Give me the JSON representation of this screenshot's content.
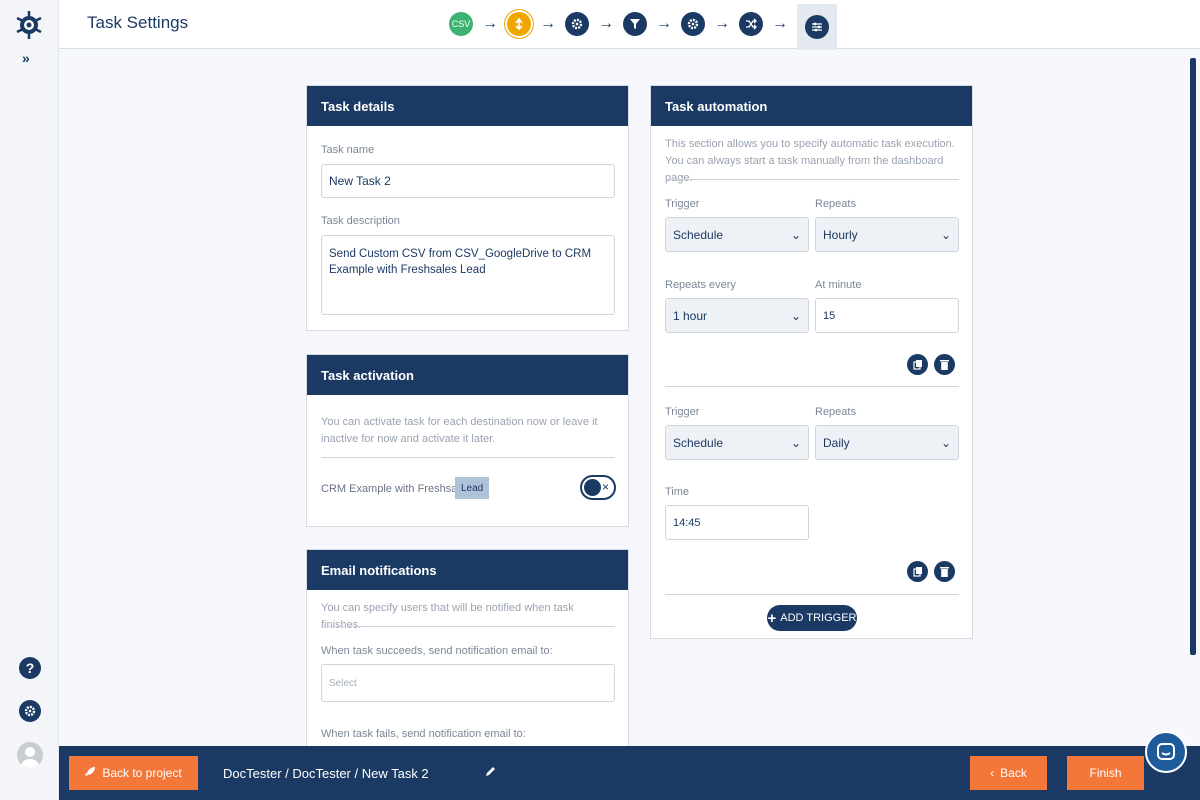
{
  "header": {
    "title": "Task Settings"
  },
  "steps": [
    {
      "id": "csv",
      "label": "CSV"
    },
    {
      "id": "source",
      "icon": "bolt-icon"
    },
    {
      "id": "settings",
      "icon": "gear-icon"
    },
    {
      "id": "filter",
      "icon": "filter-icon"
    },
    {
      "id": "settings2",
      "icon": "gear-icon"
    },
    {
      "id": "mapping",
      "icon": "shuffle-icon"
    },
    {
      "id": "task-settings",
      "icon": "sliders-icon"
    }
  ],
  "task_details": {
    "title": "Task details",
    "name_label": "Task name",
    "name_value": "New Task 2",
    "description_label": "Task description",
    "description_value": "Send Custom CSV from CSV_GoogleDrive to CRM Example with Freshsales Lead"
  },
  "task_activation": {
    "title": "Task activation",
    "info": "You can activate task for each destination now or leave it inactive for now and activate it later.",
    "destination": "CRM Example with Freshsales",
    "badge": "Lead",
    "toggle_symbol": "×"
  },
  "email_notifications": {
    "title": "Email notifications",
    "info": "You can specify users that will be notified when task finishes.",
    "success_label": "When task succeeds, send notification email to:",
    "success_placeholder": "Select",
    "fail_label": "When task fails, send notification email to:"
  },
  "task_automation": {
    "title": "Task automation",
    "info": "This section allows you to specify automatic task execution. You can always start a task manually from the dashboard page.",
    "trigger1": {
      "trigger_label": "Trigger",
      "trigger_value": "Schedule",
      "repeats_label": "Repeats",
      "repeats_value": "Hourly",
      "every_label": "Repeats every",
      "every_value": "1 hour",
      "minute_label": "At minute",
      "minute_value": "15"
    },
    "trigger2": {
      "trigger_label": "Trigger",
      "trigger_value": "Schedule",
      "repeats_label": "Repeats",
      "repeats_value": "Daily",
      "time_label": "Time",
      "time_value": "14:45"
    },
    "add_trigger": "ADD TRIGGER"
  },
  "bottom": {
    "back_to_project": "Back to project",
    "breadcrumb": "DocTester / DocTester / New Task 2",
    "back": "Back",
    "finish": "Finish"
  },
  "colors": {
    "primary": "#1b3a63",
    "accent": "#f4773a",
    "success": "#3cb371",
    "warning": "#f0a500"
  }
}
